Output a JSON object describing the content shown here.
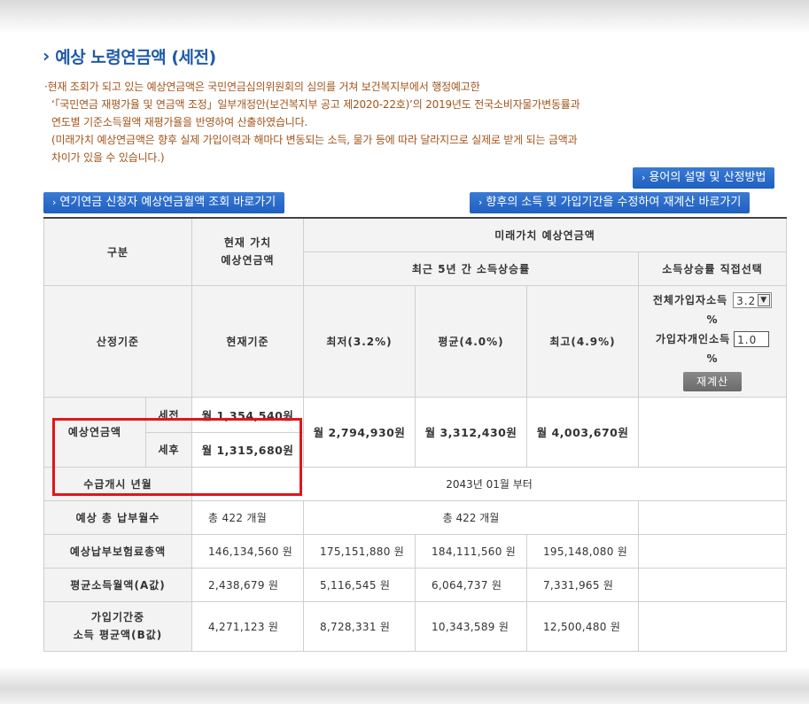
{
  "page": {
    "title": "예상 노령연금액 (세전)"
  },
  "notice": {
    "lines": [
      "·현재 조회가 되고 있는 예상연금액은 국민연금심의위원회의 심의를 거쳐 보건복지부에서 행정예고한",
      "‘「국민연금 재평가율 및 연금액 조정」일부개정안(보건복지부 공고 제2020-22호)’의 2019년도 전국소비자물가변동률과",
      "연도별 기준소득월액 재평가율을 반영하여 산출하였습니다.",
      "(미래가치 예상연금액은 향후 실제 가입이력과 해마다 변동되는 소득, 물가 등에 따라 달라지므로 실제로 받게 되는 금액과",
      "차이가 있을 수 있습니다.)"
    ]
  },
  "buttons": {
    "terms": "용어의 설명 및 산정방법",
    "applicant_lookup": "연기연금 신청자 예상연금월액 조회 바로가기",
    "recalculate_link": "향후의 소득 및 가입기간을 수정하여 재계산 바로가기",
    "recalc": "재계산"
  },
  "table": {
    "col_category": "구분",
    "col_present": "현재 가치\n예상연금액",
    "col_future": "미래가치 예상연금액",
    "col_recent5": "최근 5년 간 소득상승률",
    "col_direct": "소득상승률 직접선택",
    "basis_label": "산정기준",
    "basis_present": "현재기준",
    "basis_low": "최저(3.2%)",
    "basis_avg": "평균(4.0%)",
    "basis_high": "최고(4.9%)",
    "direct": {
      "all_income_label": "전체가입자소득",
      "all_income_value": "3.2",
      "percent1": "%",
      "individual_label": "가입자개인소득",
      "individual_value": "1.0",
      "percent2": "%"
    },
    "pension_label": "예상연금액",
    "pre_tax_label": "세전",
    "post_tax_label": "세후",
    "pre_tax_present": "월 1,354,540원",
    "post_tax_present": "월 1,315,680원",
    "future_low": "월 2,794,930원",
    "future_avg": "월 3,312,430원",
    "future_high": "월 4,003,670원",
    "start_label": "수급개시 년월",
    "start_value": "2043년 01월 부터",
    "months_label": "예상 총 납부월수",
    "months_present": "총 422 개월",
    "months_future": "총 422 개월",
    "premium_label": "예상납부보험료총액",
    "premium": [
      "146,134,560 원",
      "175,151,880 원",
      "184,111,560 원",
      "195,148,080 원"
    ],
    "a_label": "평균소득월액(A값)",
    "a_values": [
      "2,438,679 원",
      "5,116,545 원",
      "6,064,737 원",
      "7,331,965 원"
    ],
    "b_label": "가입기간중\n소득 평균액(B값)",
    "b_values": [
      "4,271,123 원",
      "8,728,331 원",
      "10,343,589 원",
      "12,500,480 원"
    ]
  },
  "colors": {
    "accent_blue": "#1f5aa6",
    "notice_orange": "#a2541a",
    "highlight_red": "#e0161c"
  }
}
